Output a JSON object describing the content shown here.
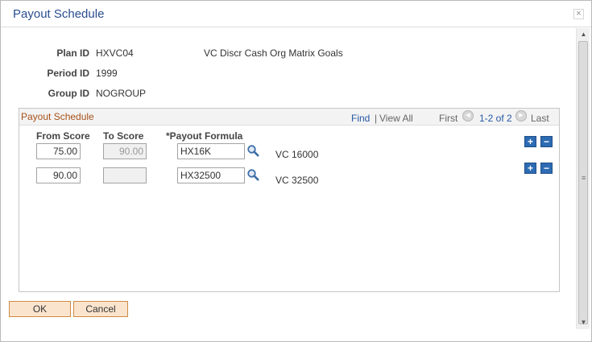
{
  "window": {
    "title": "Payout Schedule",
    "close_label": "×"
  },
  "fields": {
    "plan_id_label": "Plan ID",
    "plan_id": "HXVC04",
    "plan_description": "VC Discr Cash Org Matrix Goals",
    "period_id_label": "Period ID",
    "period_id": "1999",
    "group_id_label": "Group ID",
    "group_id": "NOGROUP"
  },
  "grid": {
    "title": "Payout Schedule",
    "find": "Find",
    "separator": "|",
    "view_all": "View All",
    "first": "First",
    "range": "1-2 of 2",
    "last": "Last",
    "columns": {
      "from_score": "From Score",
      "to_score": "To Score",
      "payout_formula": "*Payout Formula"
    },
    "rows": [
      {
        "from_score": "75.00",
        "to_score": "90.00",
        "payout_formula": "HX16K",
        "description": "VC 16000"
      },
      {
        "from_score": "90.00",
        "to_score": "",
        "payout_formula": "HX32500",
        "description": "VC 32500"
      }
    ],
    "add_label": "+",
    "delete_label": "−"
  },
  "buttons": {
    "ok": "OK",
    "cancel": "Cancel"
  },
  "scroll": {
    "up": "▲",
    "down": "▼",
    "grip": "≡"
  },
  "icons": {
    "lookup": "magnifier-icon",
    "prev": "◀",
    "next": "▶"
  }
}
